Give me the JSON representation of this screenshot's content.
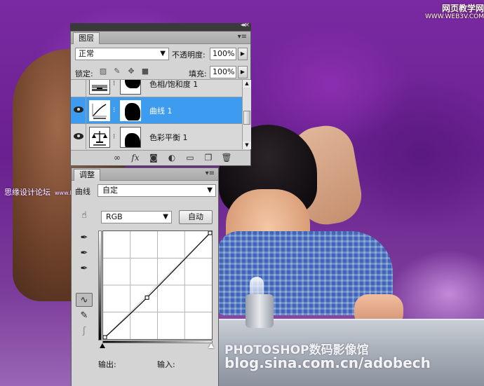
{
  "watermarks": {
    "top_right_cn": "网页教学网",
    "top_right_url": "WWW.WEB3V.COM",
    "left_cn": "思缘设计论坛",
    "left_en": "www.MISSYUAN.COM",
    "bottom_line1": "PHOTOSHOP数码影像馆",
    "bottom_line2": "blog.sina.com.cn/adobech"
  },
  "layers_panel": {
    "tab_label": "图层",
    "blend_mode": "正常",
    "opacity_label": "不透明度:",
    "opacity_value": "100%",
    "lock_label": "锁定:",
    "fill_label": "填充:",
    "fill_value": "100%",
    "layers": [
      {
        "name": "色相/饱和度 1",
        "visible": false,
        "selected": false,
        "icon": "hue-saturation-icon"
      },
      {
        "name": "曲线 1",
        "visible": true,
        "selected": true,
        "icon": "curves-icon"
      },
      {
        "name": "色彩平衡 1",
        "visible": true,
        "selected": false,
        "icon": "color-balance-icon"
      }
    ],
    "footer_icons": [
      "link-layers-icon",
      "fx-icon",
      "layer-mask-icon",
      "adjustment-layer-icon",
      "group-icon",
      "new-layer-icon",
      "trash-icon"
    ]
  },
  "adjust_panel": {
    "tab_label": "调整",
    "preset_label": "曲线",
    "preset_value": "自定",
    "channel": "RGB",
    "auto_label": "自动",
    "output_label": "输出:",
    "input_label": "输入:",
    "curve": {
      "points": [
        [
          0,
          0
        ],
        [
          103,
          98
        ],
        [
          255,
          255
        ]
      ]
    },
    "tools": [
      "target-adjust-icon",
      "black-eyedropper-icon",
      "gray-eyedropper-icon",
      "white-eyedropper-icon",
      "curve-points-icon",
      "pencil-icon",
      "smooth-icon"
    ]
  }
}
